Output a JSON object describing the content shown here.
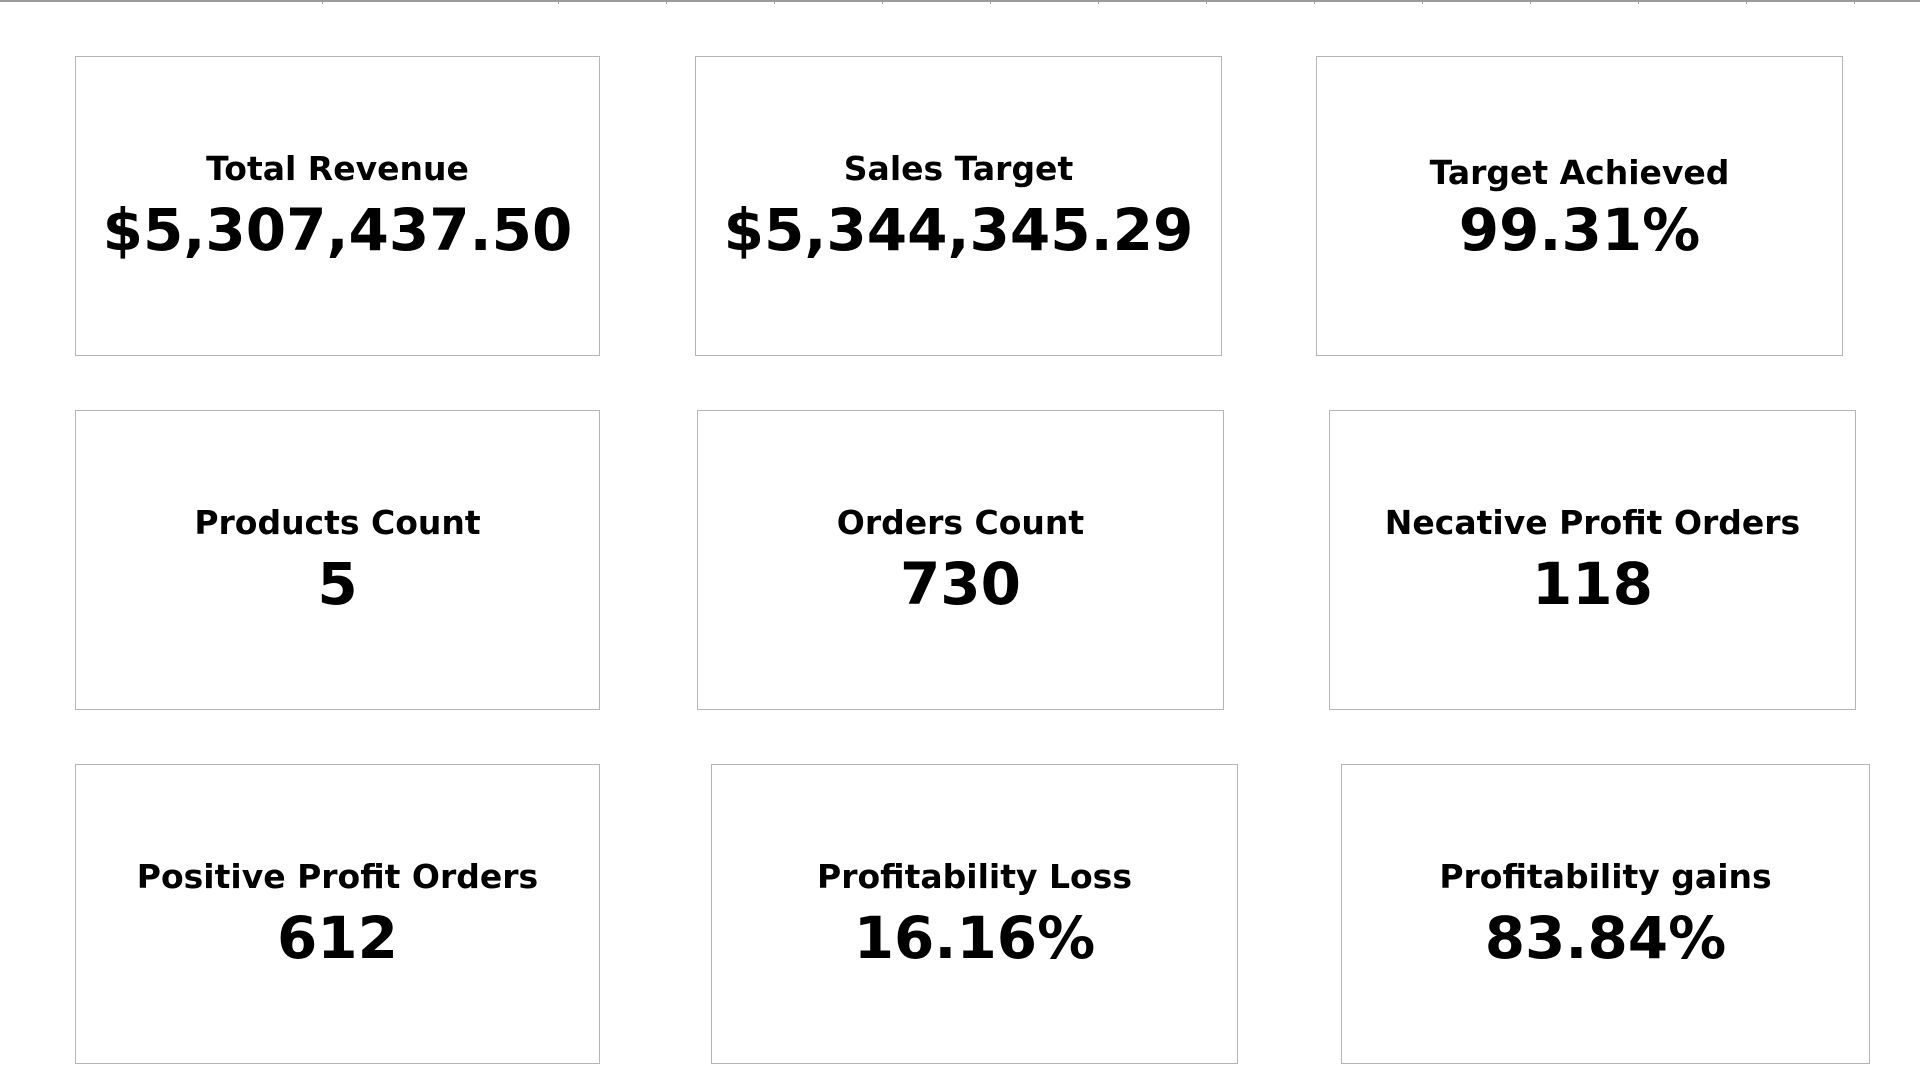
{
  "kpis": [
    {
      "label": "Total Revenue",
      "value": "$5,307,437.50"
    },
    {
      "label": "Sales Target",
      "value": "$5,344,345.29"
    },
    {
      "label": "Target Achieved",
      "value": "99.31%"
    },
    {
      "label": "Products Count",
      "value": "5"
    },
    {
      "label": "Orders Count",
      "value": "730"
    },
    {
      "label": "Necative Profit Orders",
      "value": "118"
    },
    {
      "label": "Positive Profit Orders",
      "value": "612"
    },
    {
      "label": "Profitability Loss",
      "value": "16.16%"
    },
    {
      "label": "Profitability gains",
      "value": "83.84%"
    }
  ]
}
